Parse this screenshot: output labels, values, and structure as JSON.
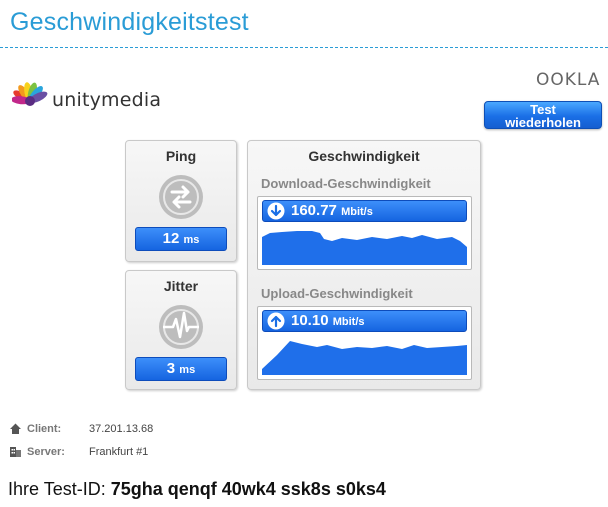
{
  "header": {
    "title": "Geschwindigkeitstest"
  },
  "brand": {
    "name": "unitymedia",
    "ookla": "OOKLA"
  },
  "actions": {
    "retest_line1": "Test",
    "retest_line2": "wiederholen"
  },
  "ping": {
    "title": "Ping",
    "value": "12",
    "unit": "ms"
  },
  "jitter": {
    "title": "Jitter",
    "value": "3",
    "unit": "ms"
  },
  "speed": {
    "title": "Geschwindigkeit",
    "download": {
      "label": "Download-Geschwindigkeit",
      "value": "160.77",
      "unit": "Mbit/s"
    },
    "upload": {
      "label": "Upload-Geschwindigkeit",
      "value": "10.10",
      "unit": "Mbit/s"
    }
  },
  "info": {
    "client_label": "Client:",
    "client_value": "37.201.13.68",
    "server_label": "Server:",
    "server_value": "Frankfurt #1"
  },
  "test_id": {
    "label": "Ihre Test-ID:",
    "value": "75gha qenqf 40wk4 ssk8s s0ks4"
  },
  "colors": {
    "title_blue": "#2a9cd6",
    "accent_blue": "#1a6fe6"
  }
}
